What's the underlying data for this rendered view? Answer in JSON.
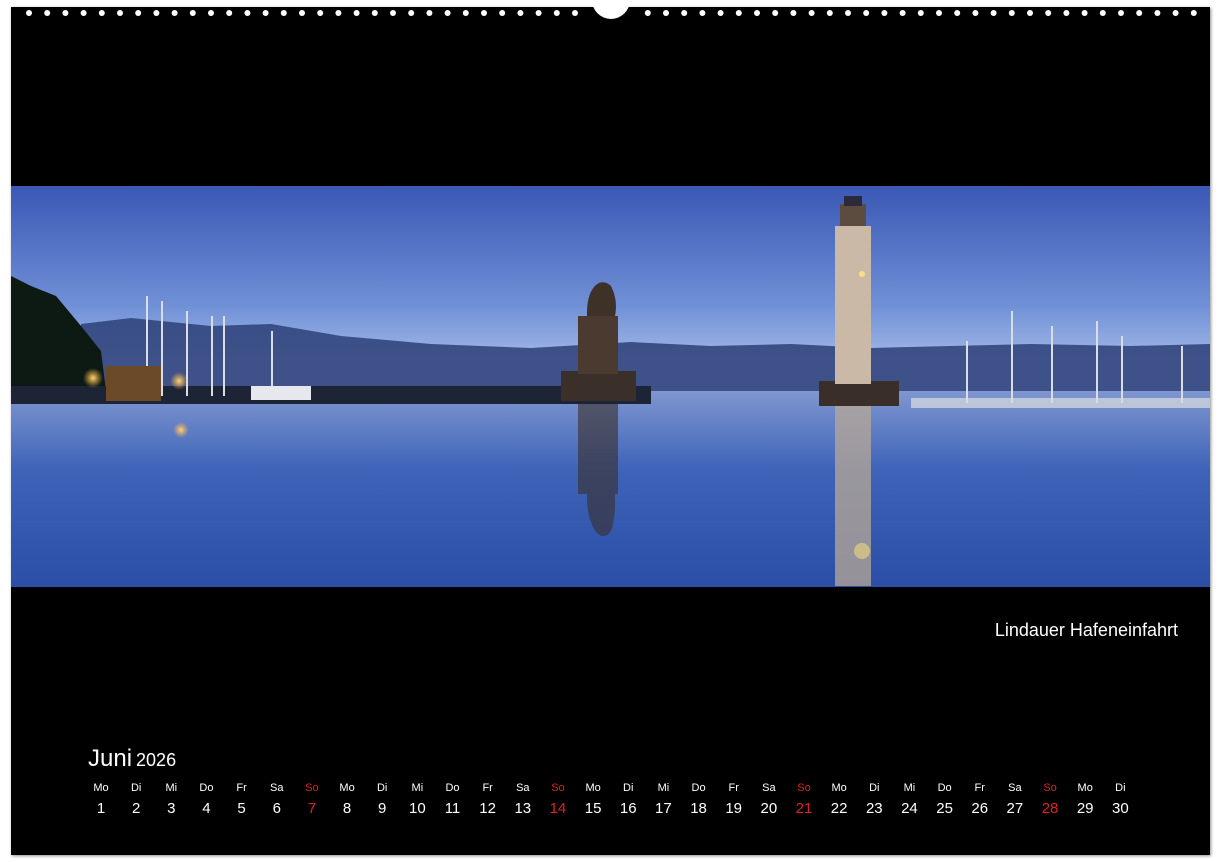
{
  "caption": "Lindauer Hafeneinfahrt",
  "calendar": {
    "month": "Juni",
    "year": "2026",
    "days": [
      {
        "dn": "Mo",
        "d": "1",
        "sun": false
      },
      {
        "dn": "Di",
        "d": "2",
        "sun": false
      },
      {
        "dn": "Mi",
        "d": "3",
        "sun": false
      },
      {
        "dn": "Do",
        "d": "4",
        "sun": false
      },
      {
        "dn": "Fr",
        "d": "5",
        "sun": false
      },
      {
        "dn": "Sa",
        "d": "6",
        "sun": false
      },
      {
        "dn": "So",
        "d": "7",
        "sun": true
      },
      {
        "dn": "Mo",
        "d": "8",
        "sun": false
      },
      {
        "dn": "Di",
        "d": "9",
        "sun": false
      },
      {
        "dn": "Mi",
        "d": "10",
        "sun": false
      },
      {
        "dn": "Do",
        "d": "11",
        "sun": false
      },
      {
        "dn": "Fr",
        "d": "12",
        "sun": false
      },
      {
        "dn": "Sa",
        "d": "13",
        "sun": false
      },
      {
        "dn": "So",
        "d": "14",
        "sun": true
      },
      {
        "dn": "Mo",
        "d": "15",
        "sun": false
      },
      {
        "dn": "Di",
        "d": "16",
        "sun": false
      },
      {
        "dn": "Mi",
        "d": "17",
        "sun": false
      },
      {
        "dn": "Do",
        "d": "18",
        "sun": false
      },
      {
        "dn": "Fr",
        "d": "19",
        "sun": false
      },
      {
        "dn": "Sa",
        "d": "20",
        "sun": false
      },
      {
        "dn": "So",
        "d": "21",
        "sun": true
      },
      {
        "dn": "Mo",
        "d": "22",
        "sun": false
      },
      {
        "dn": "Di",
        "d": "23",
        "sun": false
      },
      {
        "dn": "Mi",
        "d": "24",
        "sun": false
      },
      {
        "dn": "Do",
        "d": "25",
        "sun": false
      },
      {
        "dn": "Fr",
        "d": "26",
        "sun": false
      },
      {
        "dn": "Sa",
        "d": "27",
        "sun": false
      },
      {
        "dn": "So",
        "d": "28",
        "sun": true
      },
      {
        "dn": "Mo",
        "d": "29",
        "sun": false
      },
      {
        "dn": "Di",
        "d": "30",
        "sun": false
      }
    ]
  },
  "colors": {
    "background": "#000000",
    "text": "#ffffff",
    "sunday": "#e02020",
    "sky_top": "#3d5cb8",
    "sky_horizon": "#8aa8e0",
    "water": "#2a4fa8"
  }
}
